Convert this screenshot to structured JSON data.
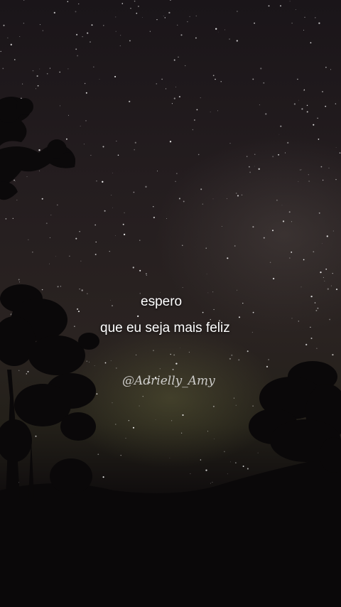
{
  "caption": {
    "line1": "espero",
    "line2": "que eu seja mais feliz"
  },
  "watermark": "@Adrielly_Amy"
}
